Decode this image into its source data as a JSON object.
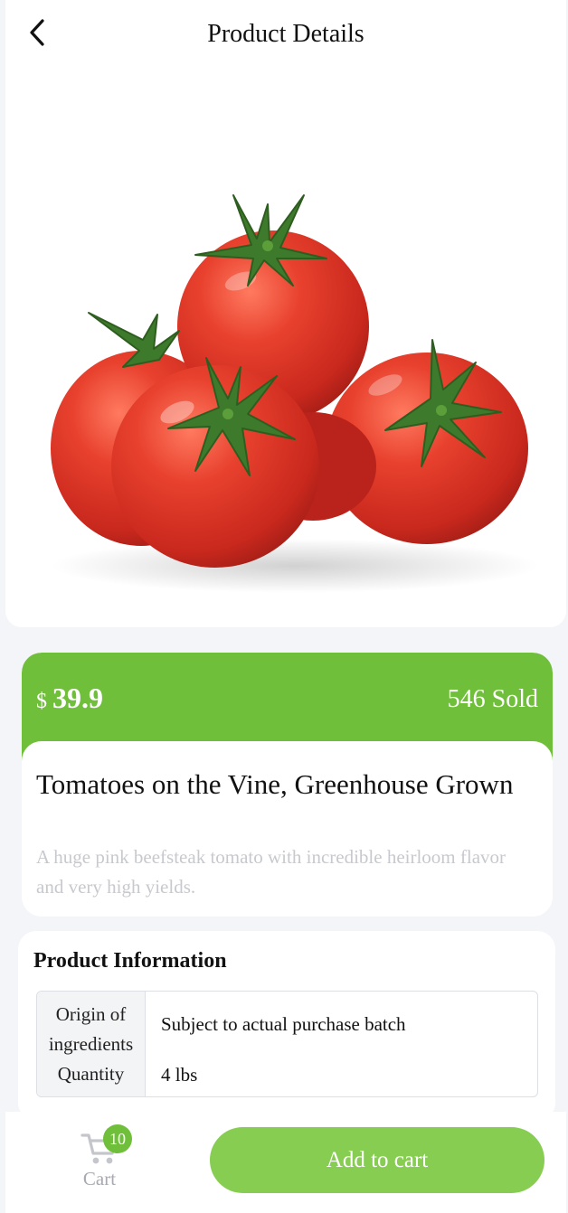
{
  "header": {
    "title": "Product Details"
  },
  "product": {
    "currency": "$",
    "price": "39.9",
    "sold": "546 Sold",
    "name": "Tomatoes on the Vine, Greenhouse Grown",
    "description": "A huge pink beefsteak tomato with incredible heirloom flavor and very high yields."
  },
  "product_info": {
    "title": "Product Information",
    "rows": [
      {
        "label": "Origin of ingredients",
        "value": "Subject to actual purchase batch"
      },
      {
        "label": "Quantity",
        "value": "4 lbs"
      }
    ]
  },
  "bottom": {
    "cart_label": "Cart",
    "cart_count": "10",
    "add_label": "Add to cart"
  },
  "colors": {
    "accent": "#6fbf3a",
    "button": "#86cd52",
    "tomato": "#e23a2a"
  },
  "icons": {
    "back": "chevron-left-icon",
    "cart": "shopping-cart-icon"
  }
}
